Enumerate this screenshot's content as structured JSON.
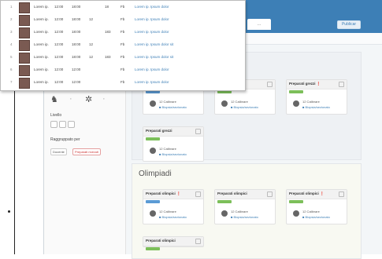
{
  "header": {
    "tab_label": "…",
    "right_button": "Publicar"
  },
  "sidebar": {
    "levels_label": "Livello",
    "filters_label": "Raggruppato per",
    "chips": [
      "Docente",
      "Preparati ricevuti"
    ]
  },
  "panels": [
    {
      "title": "",
      "cards": [
        {
          "title": "Preparati grezzi",
          "flag": "",
          "badge": "blue",
          "line1": "12 Calibrare",
          "line2": "■ Biopsia/sezionato"
        },
        {
          "title": "Preparati grezzi",
          "flag": "",
          "badge": "green",
          "line1": "12 Calibrare",
          "line2": "■ Biopsia/sezionato"
        },
        {
          "title": "Preparati grezzi",
          "flag": "❗",
          "badge": "green",
          "line1": "12 Calibrare",
          "line2": "■ Biopsia/sezionato"
        },
        {
          "title": "Preparati grezzi",
          "flag": "",
          "badge": "green",
          "line1": "12 Calibrare",
          "line2": "■ Biopsia/sezionato"
        }
      ]
    },
    {
      "title": "Olimpiadi",
      "cards": [
        {
          "title": "Preparati olimpici",
          "flag": "❗",
          "badge": "blue",
          "line1": "12 Calibrare",
          "line2": "■ Biopsia/sezionato"
        },
        {
          "title": "Preparati olimpici",
          "flag": "",
          "badge": "green",
          "line1": "12 Calibrare",
          "line2": "■ Biopsia/sezionato"
        },
        {
          "title": "Preparati olimpici",
          "flag": "❗",
          "badge": "green",
          "line1": "12 Calibrare",
          "line2": "■ Biopsia/sezionato"
        },
        {
          "title": "Preparati olimpici",
          "flag": "",
          "badge": "green",
          "line1": "",
          "line2": ""
        }
      ]
    }
  ],
  "popup_rows": [
    {
      "num": "1",
      "c1": "Lorem ip.",
      "c2": "12:00",
      "c3": "18:00",
      "c4": "",
      "c5": "18",
      "c6": "Fb",
      "link": "Lorem ip. Ipsum dolor"
    },
    {
      "num": "2",
      "c1": "Lorem ip.",
      "c2": "12:00",
      "c3": "18:00",
      "c4": "12",
      "c5": "",
      "c6": "Fb",
      "link": "Lorem ip. Ipsum dolor"
    },
    {
      "num": "3",
      "c1": "Lorem ip.",
      "c2": "12:00",
      "c3": "18:00",
      "c4": "",
      "c5": "183",
      "c6": "Fb",
      "link": "Lorem ip. Ipsum dolor"
    },
    {
      "num": "4",
      "c1": "Lorem ip.",
      "c2": "12:00",
      "c3": "18:00",
      "c4": "12",
      "c5": "",
      "c6": "Fb",
      "link": "Lorem ip. Ipsum dolor sit"
    },
    {
      "num": "5",
      "c1": "Lorem ip.",
      "c2": "12:00",
      "c3": "18:00",
      "c4": "12",
      "c5": "183",
      "c6": "Fb",
      "link": "Lorem ip. Ipsum dolor sit"
    },
    {
      "num": "6",
      "c1": "Lorem ip.",
      "c2": "12:00",
      "c3": "12:00",
      "c4": "",
      "c5": "",
      "c6": "Fb",
      "link": "Lorem ip. Ipsum dolor"
    },
    {
      "num": "7",
      "c1": "Lorem ip.",
      "c2": "12:00",
      "c3": "12:00",
      "c4": "",
      "c5": "",
      "c6": "Fb",
      "link": "Lorem ip. Ipsum dolor"
    }
  ]
}
